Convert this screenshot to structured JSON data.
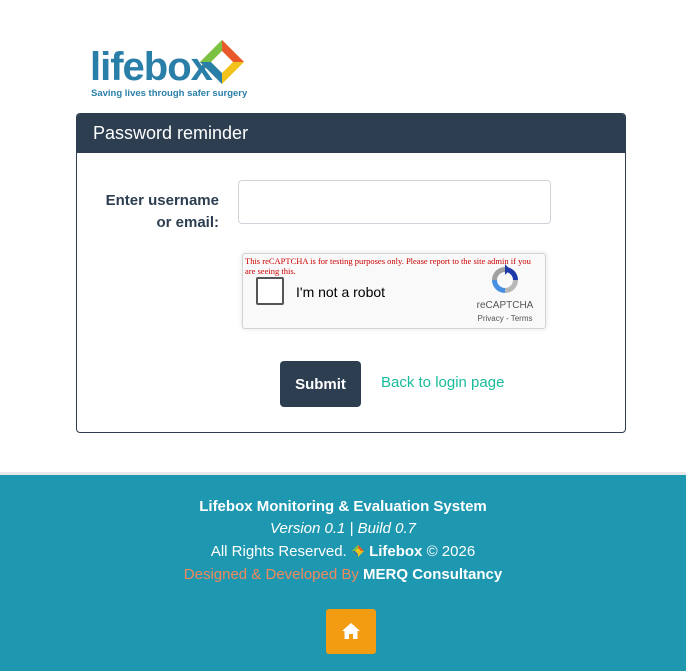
{
  "logo": {
    "wordmark": "lifebox",
    "tagline": "Saving lives through safer surgery"
  },
  "card": {
    "title": "Password reminder",
    "field_label": "Enter username or email:",
    "field_value": "",
    "recaptcha": {
      "warning": "This reCAPTCHA is for testing purposes only. Please report to the site admin if you are seeing this.",
      "checkbox_label": "I'm not a robot",
      "brand": "reCAPTCHA",
      "links": "Privacy - Terms"
    },
    "submit_label": "Submit",
    "back_link_label": "Back to login page"
  },
  "footer": {
    "system_name": "Lifebox Monitoring & Evaluation System",
    "version": "Version 0.1 | Build 0.7",
    "rights_prefix": "All Rights Reserved.",
    "rights_brand": "Lifebox",
    "rights_suffix": "© 2026",
    "designed_by": "Designed & Developed By",
    "designer": "MERQ Consultancy",
    "home_icon": "home-icon"
  },
  "colors": {
    "header_bg": "#2c3e50",
    "footer_bg": "#1e97b0",
    "link": "#18bc9c",
    "home_button": "#f39c12",
    "designed_by_text": "#f08a5d"
  }
}
